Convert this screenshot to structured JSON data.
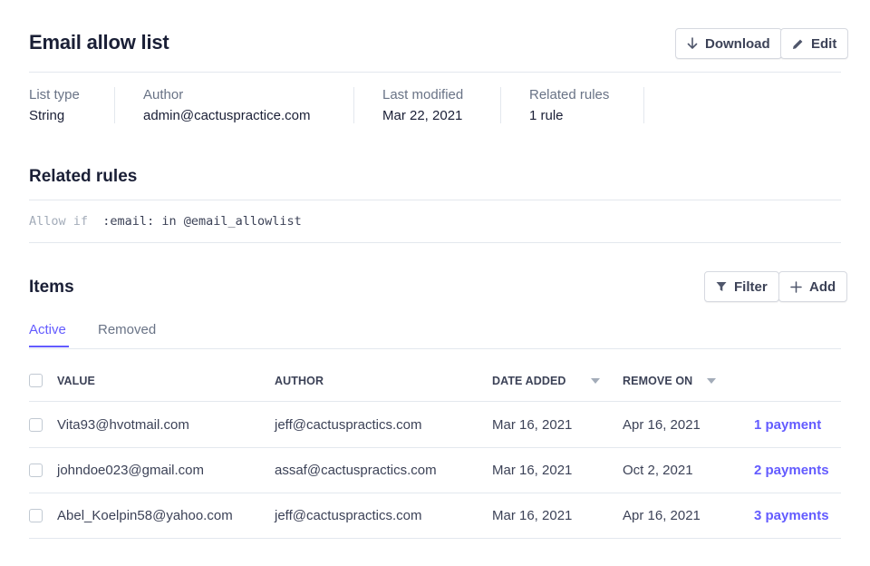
{
  "header": {
    "title": "Email allow list",
    "download_label": "Download",
    "edit_label": "Edit"
  },
  "meta": [
    {
      "label": "List type",
      "value": "String"
    },
    {
      "label": "Author",
      "value": "admin@cactuspractice.com"
    },
    {
      "label": "Last modified",
      "value": "Mar 22, 2021"
    },
    {
      "label": "Related rules",
      "value": "1 rule"
    }
  ],
  "related_rules": {
    "title": "Related rules",
    "rule_keyword": "Allow if",
    "rule_expression": ":email: in @email_allowlist"
  },
  "items": {
    "title": "Items",
    "filter_label": "Filter",
    "add_label": "Add",
    "tabs": [
      {
        "label": "Active",
        "active": true
      },
      {
        "label": "Removed",
        "active": false
      }
    ],
    "columns": [
      "VALUE",
      "AUTHOR",
      "DATE ADDED",
      "REMOVE ON"
    ],
    "rows": [
      {
        "value": "Vita93@hvotmail.com",
        "author": "jeff@cactuspractics.com",
        "date_added": "Mar 16, 2021",
        "remove_on": "Apr 16, 2021",
        "payments": "1 payment"
      },
      {
        "value": "johndoe023@gmail.com",
        "author": "assaf@cactuspractics.com",
        "date_added": "Mar 16, 2021",
        "remove_on": "Oct 2, 2021",
        "payments": "2 payments"
      },
      {
        "value": "Abel_Koelpin58@yahoo.com",
        "author": "jeff@cactuspractics.com",
        "date_added": "Mar 16, 2021",
        "remove_on": "Apr 16, 2021",
        "payments": "3 payments"
      }
    ]
  },
  "colors": {
    "accent": "#635bff",
    "text": "#1a1f36",
    "muted": "#697386",
    "border": "#e3e8ee"
  }
}
